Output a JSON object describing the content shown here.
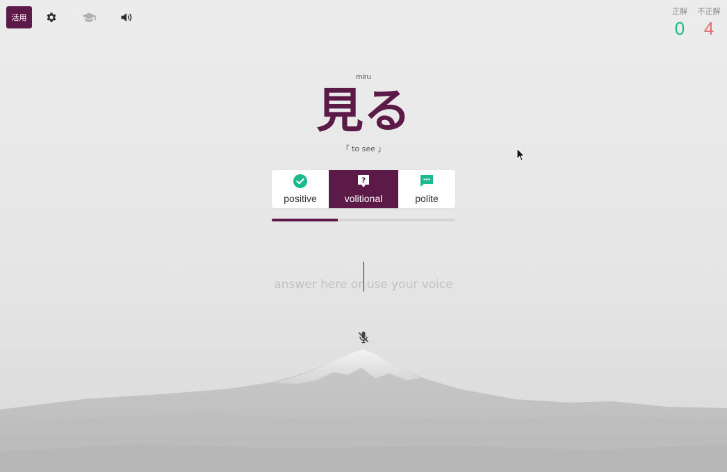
{
  "app": {
    "logo_label": "活用"
  },
  "toolbar": {
    "icons": [
      "gear-icon",
      "graduation-cap-icon",
      "speaker-icon"
    ]
  },
  "score": {
    "correct_label": "正解",
    "correct_value": "0",
    "wrong_label": "不正解",
    "wrong_value": "4"
  },
  "word": {
    "romaji": "miru",
    "kanji": "見る",
    "meaning": "「 to see 」"
  },
  "forms": [
    {
      "label": "positive",
      "icon": "check-circle-icon",
      "active": false
    },
    {
      "label": "volitional",
      "icon": "question-icon",
      "active": true
    },
    {
      "label": "polite",
      "icon": "speech-bubble-icon",
      "active": false
    }
  ],
  "progress": {
    "fraction": 0.36
  },
  "answer": {
    "placeholder": "answer here or use your voice",
    "value": ""
  },
  "mic": {
    "icon": "mic-muted-icon"
  },
  "colors": {
    "accent": "#5c1a48",
    "correct": "#1aba8c",
    "wrong": "#e86b6b",
    "background": "#ececec"
  }
}
